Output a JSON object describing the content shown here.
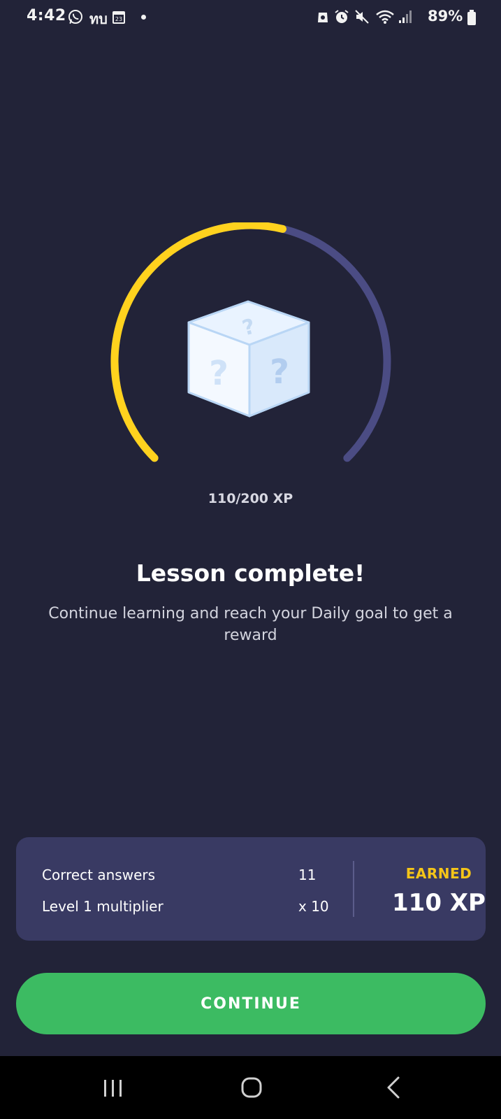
{
  "status_bar": {
    "time": "4:42",
    "carrier": "ทบ",
    "calendar_day": "23",
    "battery": "89%",
    "icons": [
      "whatsapp-icon",
      "calendar-icon",
      "shield-icon",
      "alarm-icon",
      "mute-icon",
      "wifi-icon",
      "signal-icon",
      "battery-icon"
    ]
  },
  "progress": {
    "current": 110,
    "max": 200,
    "text": "110/200 XP",
    "fill_color": "#FFD21E",
    "track_color": "#4B4C84"
  },
  "reward_icon": "mystery-box-icon",
  "lesson": {
    "title": "Lesson complete!",
    "subtitle": "Continue learning and reach your Daily goal to get a reward"
  },
  "summary": {
    "rows": [
      {
        "label": "Correct answers",
        "value": "11"
      },
      {
        "label": "Level 1 multiplier",
        "value": "x 10"
      }
    ],
    "earned_label": "EARNED",
    "earned_value": "110 XP"
  },
  "continue_label": "CONTINUE",
  "nav": {
    "recents": "recents-icon",
    "home": "home-icon",
    "back": "back-icon"
  },
  "colors": {
    "background": "#222338",
    "card": "#393A63",
    "accent_green": "#3CBB62",
    "earned_yellow": "#F5C518"
  }
}
